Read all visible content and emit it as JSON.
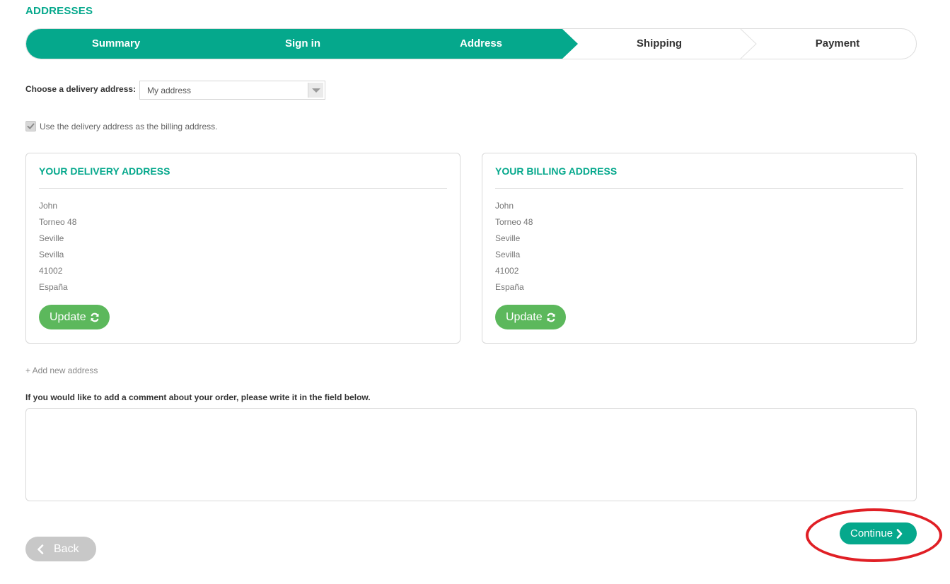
{
  "page": {
    "title": "ADDRESSES"
  },
  "steps": [
    {
      "label": "Summary",
      "state": "done"
    },
    {
      "label": "Sign in",
      "state": "done"
    },
    {
      "label": "Address",
      "state": "current"
    },
    {
      "label": "Shipping",
      "state": "todo"
    },
    {
      "label": "Payment",
      "state": "todo"
    }
  ],
  "delivery_select": {
    "label": "Choose a delivery address:",
    "value": "My address"
  },
  "billing_checkbox": {
    "label": "Use the delivery address as the billing address.",
    "checked": true
  },
  "delivery_address": {
    "title": "YOUR DELIVERY ADDRESS",
    "lines": [
      "John",
      "Torneo 48",
      "Seville",
      "Sevilla",
      "41002",
      "España"
    ],
    "update_label": "Update"
  },
  "billing_address": {
    "title": "YOUR BILLING ADDRESS",
    "lines": [
      "John",
      "Torneo 48",
      "Seville",
      "Sevilla",
      "41002",
      "España"
    ],
    "update_label": "Update"
  },
  "add_new_address": "+ Add new address",
  "comment": {
    "label": "If you would like to add a comment about your order, please write it in the field below.",
    "value": ""
  },
  "buttons": {
    "back": "Back",
    "continue": "Continue"
  },
  "colors": {
    "accent": "#05a88c",
    "update_button": "#5cb85c",
    "back_button": "#c8c8c8",
    "highlight": "#e01f25"
  },
  "icons": {
    "update": "refresh-icon",
    "back": "chevron-left-icon",
    "continue": "chevron-right-icon",
    "checkbox": "checkmark-icon",
    "select": "caret-down-icon"
  }
}
